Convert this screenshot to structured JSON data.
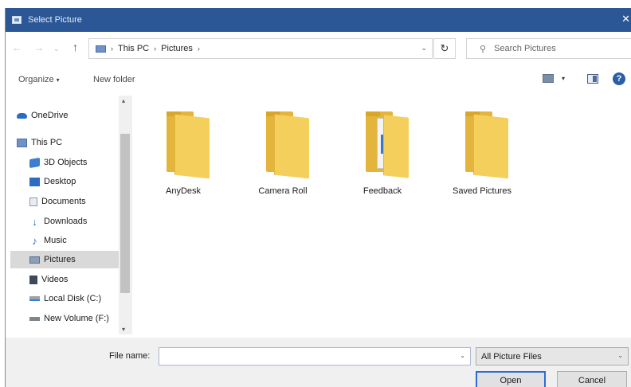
{
  "window": {
    "title": "Select Picture",
    "close_glyph": "✕"
  },
  "address_bar": {
    "crumbs": [
      "This PC",
      "Pictures"
    ],
    "separator": "›",
    "dropdown_glyph": "⌄",
    "refresh_glyph": "↻"
  },
  "nav_buttons": {
    "back": "←",
    "forward": "→",
    "recent": "⌄",
    "up": "↑"
  },
  "search": {
    "placeholder": "Search Pictures",
    "icon": "search-icon",
    "glyph": "⚲"
  },
  "command_bar": {
    "organize_label": "Organize",
    "organize_caret": "▾",
    "new_folder_label": "New folder",
    "view_caret": "▾",
    "help_glyph": "?"
  },
  "nav_pane": {
    "items": [
      {
        "label": "OneDrive",
        "icon": "onedrive-icon"
      },
      {
        "label": "This PC",
        "icon": "computer-icon"
      },
      {
        "label": "3D Objects",
        "icon": "3d-objects-icon"
      },
      {
        "label": "Desktop",
        "icon": "desktop-icon"
      },
      {
        "label": "Documents",
        "icon": "documents-icon"
      },
      {
        "label": "Downloads",
        "icon": "downloads-icon"
      },
      {
        "label": "Music",
        "icon": "music-icon"
      },
      {
        "label": "Pictures",
        "icon": "pictures-icon",
        "selected": true
      },
      {
        "label": "Videos",
        "icon": "videos-icon"
      },
      {
        "label": "Local Disk (C:)",
        "icon": "local-disk-icon"
      },
      {
        "label": "New Volume (F:)",
        "icon": "drive-icon"
      }
    ],
    "scroll_up_glyph": "▴",
    "scroll_down_glyph": "▾"
  },
  "folders": [
    {
      "label": "AnyDesk"
    },
    {
      "label": "Camera Roll"
    },
    {
      "label": "Feedback"
    },
    {
      "label": "Saved Pictures"
    }
  ],
  "bottom": {
    "file_name_label": "File name:",
    "file_name_value": "",
    "file_name_caret": "⌄",
    "file_type_value": "All Picture Files",
    "file_type_caret": "⌄",
    "open_label": "Open",
    "cancel_label": "Cancel"
  },
  "colors": {
    "titlebar": "#2b5797",
    "folder": "#f5cf5c",
    "accent": "#2e6bd8"
  }
}
